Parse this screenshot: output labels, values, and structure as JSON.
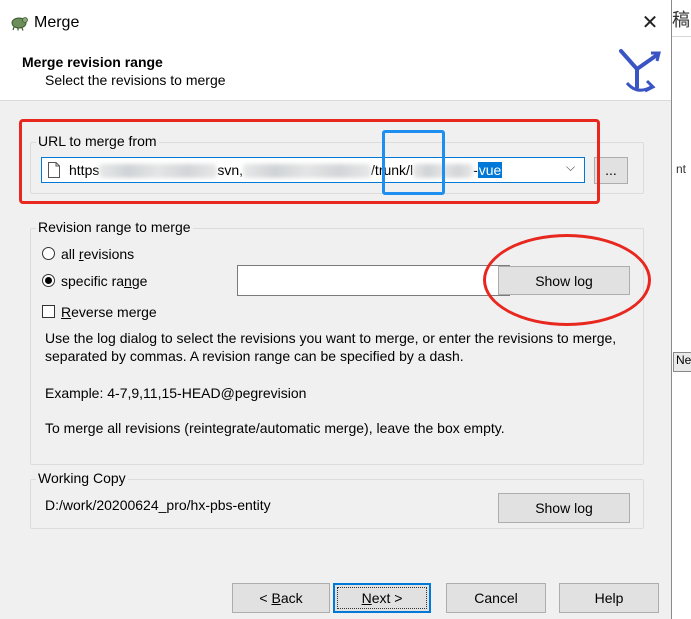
{
  "window": {
    "title": "Merge",
    "close_glyph": "✕"
  },
  "header": {
    "title": "Merge revision range",
    "subtitle": "Select the revisions to merge"
  },
  "url_group": {
    "label": "URL to merge from",
    "url_prefix": "https",
    "url_part2": "svn,",
    "url_part3": "/trunk/l",
    "url_selected": "vue",
    "url_suffix_visible": "-",
    "browse_label": "..."
  },
  "revision_group": {
    "label": "Revision range to merge",
    "all_revisions_label": "all revisions",
    "all_revisions_selected": false,
    "specific_range_label": "specific range",
    "specific_range_selected": true,
    "range_value": "",
    "show_log_label": "Show log",
    "reverse_merge_label": "Reverse merge",
    "reverse_merge_checked": false,
    "help_line1": "Use the log dialog to select the revisions you want to merge, or enter the revisions to merge, separated by commas. A revision range can be specified by a dash.",
    "help_example": "Example: 4-7,9,11,15-HEAD@pegrevision",
    "help_line3": "To merge all revisions (reintegrate/automatic merge), leave the box empty."
  },
  "working_copy": {
    "label": "Working Copy",
    "path": "D:/work/20200624_pro/hx-pbs-entity",
    "show_log_label": "Show log"
  },
  "footer": {
    "back_label": "< Back",
    "next_label": "Next >",
    "cancel_label": "Cancel",
    "help_label": "Help"
  },
  "background_window": {
    "char": "稿",
    "text_fragment": "nt",
    "button_fragment": "Ne"
  },
  "colors": {
    "annotation_red": "#e8271f",
    "annotation_blue": "#1e8ff0",
    "focus_blue": "#0078d7"
  }
}
